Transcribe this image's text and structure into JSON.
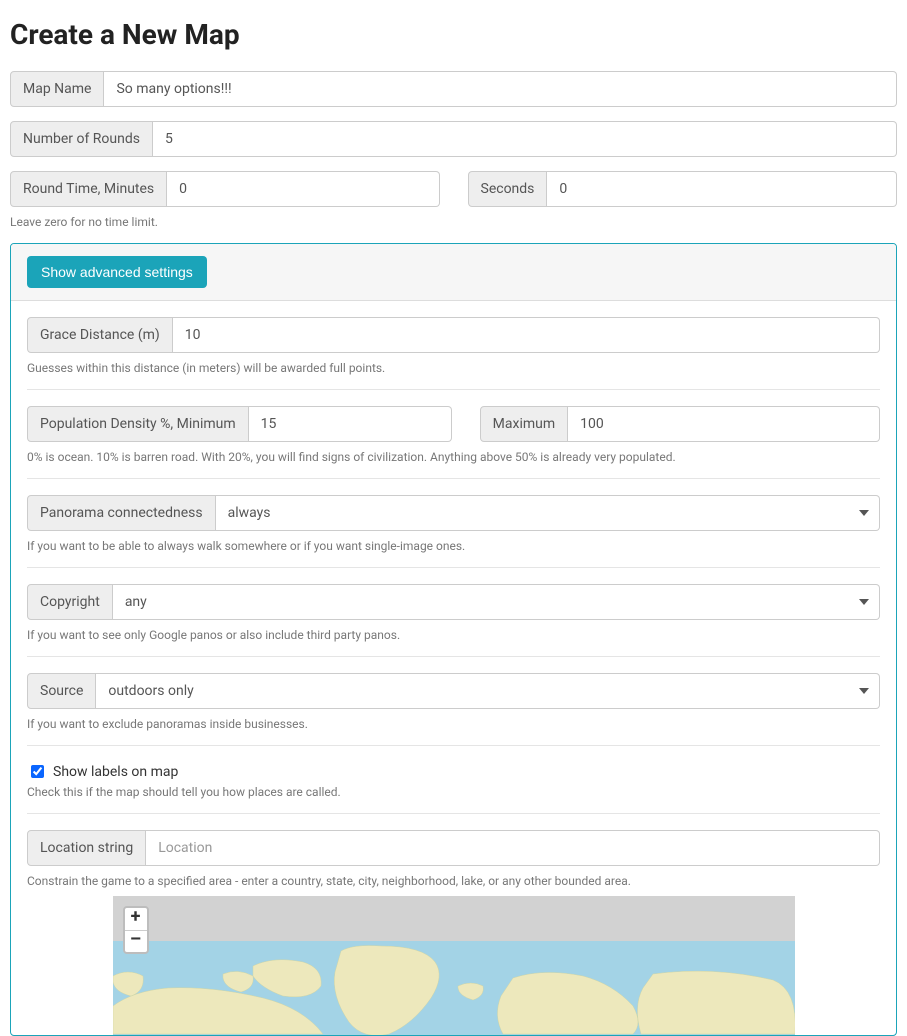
{
  "page_title": "Create a New Map",
  "map_name": {
    "label": "Map Name",
    "value": "So many options!!!"
  },
  "rounds": {
    "label": "Number of Rounds",
    "value": "5"
  },
  "round_time": {
    "minutes_label": "Round Time, Minutes",
    "minutes_value": "0",
    "seconds_label": "Seconds",
    "seconds_value": "0",
    "help": "Leave zero for no time limit."
  },
  "advanced": {
    "toggle_label": "Show advanced settings",
    "grace": {
      "label": "Grace Distance (m)",
      "value": "10",
      "help": "Guesses within this distance (in meters) will be awarded full points."
    },
    "density": {
      "min_label": "Population Density %, Minimum",
      "min_value": "15",
      "max_label": "Maximum",
      "max_value": "100",
      "help": "0% is ocean. 10% is barren road. With 20%, you will find signs of civilization. Anything above 50% is already very populated."
    },
    "connectedness": {
      "label": "Panorama connectedness",
      "value": "always",
      "help": "If you want to be able to always walk somewhere or if you want single-image ones."
    },
    "copyright": {
      "label": "Copyright",
      "value": "any",
      "help": "If you want to see only Google panos or also include third party panos."
    },
    "source": {
      "label": "Source",
      "value": "outdoors only",
      "help": "If you want to exclude panoramas inside businesses."
    },
    "show_labels": {
      "label": "Show labels on map",
      "checked": true,
      "help": "Check this if the map should tell you how places are called."
    },
    "location": {
      "label": "Location string",
      "placeholder": "Location",
      "value": "",
      "help": "Constrain the game to a specified area - enter a country, state, city, neighborhood, lake, or any other bounded area."
    },
    "zoom": {
      "in": "+",
      "out": "–"
    }
  }
}
